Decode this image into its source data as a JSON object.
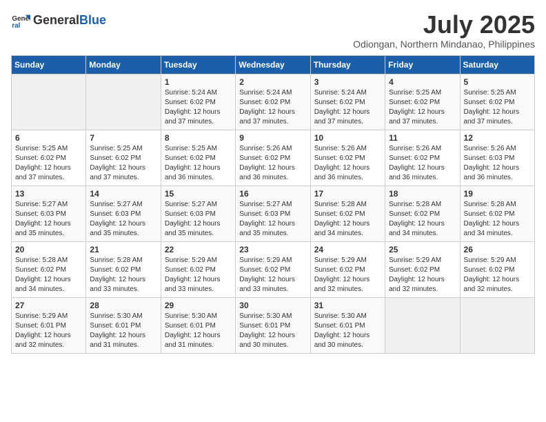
{
  "header": {
    "logo_general": "General",
    "logo_blue": "Blue",
    "month": "July 2025",
    "location": "Odiongan, Northern Mindanao, Philippines"
  },
  "days_of_week": [
    "Sunday",
    "Monday",
    "Tuesday",
    "Wednesday",
    "Thursday",
    "Friday",
    "Saturday"
  ],
  "weeks": [
    {
      "cells": [
        {
          "day": "",
          "empty": true
        },
        {
          "day": "",
          "empty": true
        },
        {
          "day": "1",
          "sunrise": "5:24 AM",
          "sunset": "6:02 PM",
          "daylight": "12 hours and 37 minutes."
        },
        {
          "day": "2",
          "sunrise": "5:24 AM",
          "sunset": "6:02 PM",
          "daylight": "12 hours and 37 minutes."
        },
        {
          "day": "3",
          "sunrise": "5:24 AM",
          "sunset": "6:02 PM",
          "daylight": "12 hours and 37 minutes."
        },
        {
          "day": "4",
          "sunrise": "5:25 AM",
          "sunset": "6:02 PM",
          "daylight": "12 hours and 37 minutes."
        },
        {
          "day": "5",
          "sunrise": "5:25 AM",
          "sunset": "6:02 PM",
          "daylight": "12 hours and 37 minutes."
        }
      ]
    },
    {
      "cells": [
        {
          "day": "6",
          "sunrise": "5:25 AM",
          "sunset": "6:02 PM",
          "daylight": "12 hours and 37 minutes."
        },
        {
          "day": "7",
          "sunrise": "5:25 AM",
          "sunset": "6:02 PM",
          "daylight": "12 hours and 37 minutes."
        },
        {
          "day": "8",
          "sunrise": "5:25 AM",
          "sunset": "6:02 PM",
          "daylight": "12 hours and 36 minutes."
        },
        {
          "day": "9",
          "sunrise": "5:26 AM",
          "sunset": "6:02 PM",
          "daylight": "12 hours and 36 minutes."
        },
        {
          "day": "10",
          "sunrise": "5:26 AM",
          "sunset": "6:02 PM",
          "daylight": "12 hours and 36 minutes."
        },
        {
          "day": "11",
          "sunrise": "5:26 AM",
          "sunset": "6:02 PM",
          "daylight": "12 hours and 36 minutes."
        },
        {
          "day": "12",
          "sunrise": "5:26 AM",
          "sunset": "6:03 PM",
          "daylight": "12 hours and 36 minutes."
        }
      ]
    },
    {
      "cells": [
        {
          "day": "13",
          "sunrise": "5:27 AM",
          "sunset": "6:03 PM",
          "daylight": "12 hours and 35 minutes."
        },
        {
          "day": "14",
          "sunrise": "5:27 AM",
          "sunset": "6:03 PM",
          "daylight": "12 hours and 35 minutes."
        },
        {
          "day": "15",
          "sunrise": "5:27 AM",
          "sunset": "6:03 PM",
          "daylight": "12 hours and 35 minutes."
        },
        {
          "day": "16",
          "sunrise": "5:27 AM",
          "sunset": "6:03 PM",
          "daylight": "12 hours and 35 minutes."
        },
        {
          "day": "17",
          "sunrise": "5:28 AM",
          "sunset": "6:02 PM",
          "daylight": "12 hours and 34 minutes."
        },
        {
          "day": "18",
          "sunrise": "5:28 AM",
          "sunset": "6:02 PM",
          "daylight": "12 hours and 34 minutes."
        },
        {
          "day": "19",
          "sunrise": "5:28 AM",
          "sunset": "6:02 PM",
          "daylight": "12 hours and 34 minutes."
        }
      ]
    },
    {
      "cells": [
        {
          "day": "20",
          "sunrise": "5:28 AM",
          "sunset": "6:02 PM",
          "daylight": "12 hours and 34 minutes."
        },
        {
          "day": "21",
          "sunrise": "5:28 AM",
          "sunset": "6:02 PM",
          "daylight": "12 hours and 33 minutes."
        },
        {
          "day": "22",
          "sunrise": "5:29 AM",
          "sunset": "6:02 PM",
          "daylight": "12 hours and 33 minutes."
        },
        {
          "day": "23",
          "sunrise": "5:29 AM",
          "sunset": "6:02 PM",
          "daylight": "12 hours and 33 minutes."
        },
        {
          "day": "24",
          "sunrise": "5:29 AM",
          "sunset": "6:02 PM",
          "daylight": "12 hours and 32 minutes."
        },
        {
          "day": "25",
          "sunrise": "5:29 AM",
          "sunset": "6:02 PM",
          "daylight": "12 hours and 32 minutes."
        },
        {
          "day": "26",
          "sunrise": "5:29 AM",
          "sunset": "6:02 PM",
          "daylight": "12 hours and 32 minutes."
        }
      ]
    },
    {
      "cells": [
        {
          "day": "27",
          "sunrise": "5:29 AM",
          "sunset": "6:01 PM",
          "daylight": "12 hours and 32 minutes."
        },
        {
          "day": "28",
          "sunrise": "5:30 AM",
          "sunset": "6:01 PM",
          "daylight": "12 hours and 31 minutes."
        },
        {
          "day": "29",
          "sunrise": "5:30 AM",
          "sunset": "6:01 PM",
          "daylight": "12 hours and 31 minutes."
        },
        {
          "day": "30",
          "sunrise": "5:30 AM",
          "sunset": "6:01 PM",
          "daylight": "12 hours and 30 minutes."
        },
        {
          "day": "31",
          "sunrise": "5:30 AM",
          "sunset": "6:01 PM",
          "daylight": "12 hours and 30 minutes."
        },
        {
          "day": "",
          "empty": true
        },
        {
          "day": "",
          "empty": true
        }
      ]
    }
  ]
}
